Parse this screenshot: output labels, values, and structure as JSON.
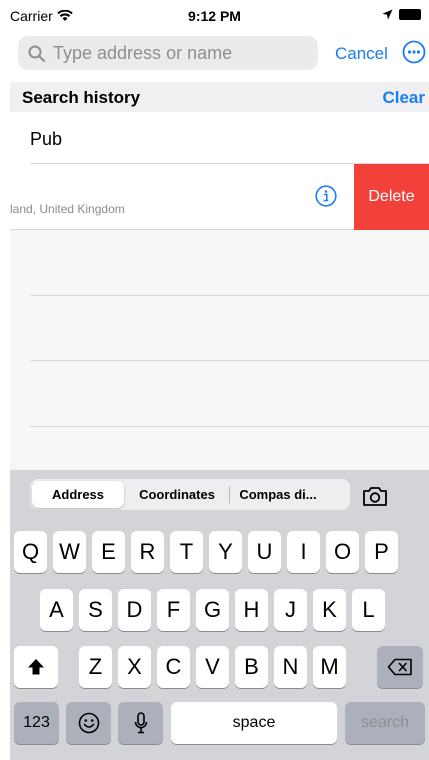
{
  "status_bar": {
    "carrier": "Carrier",
    "time": "9:12 PM"
  },
  "search": {
    "placeholder": "Type address or name",
    "cancel_label": "Cancel"
  },
  "history": {
    "title": "Search history",
    "clear_label": "Clear",
    "items": [
      {
        "title": "Pub"
      },
      {
        "subtitle": "land, United Kingdom",
        "delete_label": "Delete"
      }
    ]
  },
  "segments": [
    {
      "label": "Address",
      "selected": true
    },
    {
      "label": "Coordinates",
      "selected": false
    },
    {
      "label": "Compas di...",
      "selected": false
    }
  ],
  "keyboard": {
    "row1": [
      "Q",
      "W",
      "E",
      "R",
      "T",
      "Y",
      "U",
      "I",
      "O",
      "P"
    ],
    "row2": [
      "A",
      "S",
      "D",
      "F",
      "G",
      "H",
      "J",
      "K",
      "L"
    ],
    "row3": [
      "Z",
      "X",
      "C",
      "V",
      "B",
      "N",
      "M"
    ],
    "numbers_label": "123",
    "space_label": "space",
    "search_label": "search"
  },
  "colors": {
    "accent": "#1a7ef0",
    "delete": "#f2403a"
  }
}
